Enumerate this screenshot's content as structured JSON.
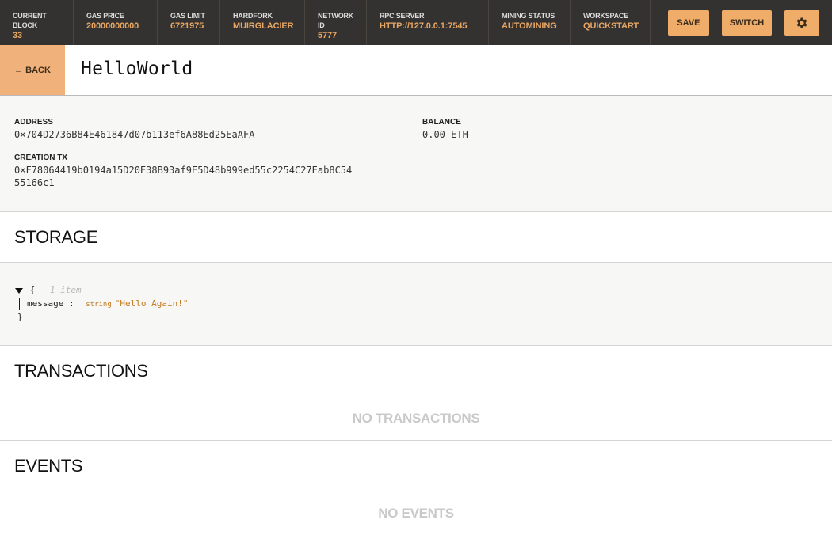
{
  "topbar": {
    "stats": [
      {
        "label": "CURRENT BLOCK",
        "value": "33"
      },
      {
        "label": "GAS PRICE",
        "value": "20000000000"
      },
      {
        "label": "GAS LIMIT",
        "value": "6721975"
      },
      {
        "label": "HARDFORK",
        "value": "MUIRGLACIER"
      },
      {
        "label": "NETWORK ID",
        "value": "5777"
      },
      {
        "label": "RPC SERVER",
        "value": "HTTP://127.0.0.1:7545"
      },
      {
        "label": "MINING STATUS",
        "value": "AUTOMINING"
      },
      {
        "label": "WORKSPACE",
        "value": "QUICKSTART"
      }
    ],
    "save_label": "SAVE",
    "switch_label": "SWITCH",
    "settings_icon": "gear-icon"
  },
  "header": {
    "back_label": "← BACK",
    "title": "HelloWorld"
  },
  "contract": {
    "address_label": "ADDRESS",
    "address": "0×704D2736B84E461847d07b113ef6A88Ed25EaAFA",
    "balance_label": "BALANCE",
    "balance": "0.00 ETH",
    "creation_tx_label": "CREATION TX",
    "creation_tx_line1": "0×F78064419b0194a15D20E38B93af9E5D48b999ed55c2254C27Eab8C54",
    "creation_tx_line2": "55166c1"
  },
  "storage": {
    "title": "STORAGE",
    "open_brace": "{",
    "item_count": "1 item",
    "key": "message",
    "separator": ":",
    "type": "string",
    "value": "\"Hello Again!\"",
    "close_brace": "}"
  },
  "transactions": {
    "title": "TRANSACTIONS",
    "empty": "NO TRANSACTIONS"
  },
  "events": {
    "title": "EVENTS",
    "empty": "NO EVENTS"
  },
  "colors": {
    "topbar_bg": "#343230",
    "accent": "#f0ad6a",
    "accent_text": "#e8a664"
  }
}
